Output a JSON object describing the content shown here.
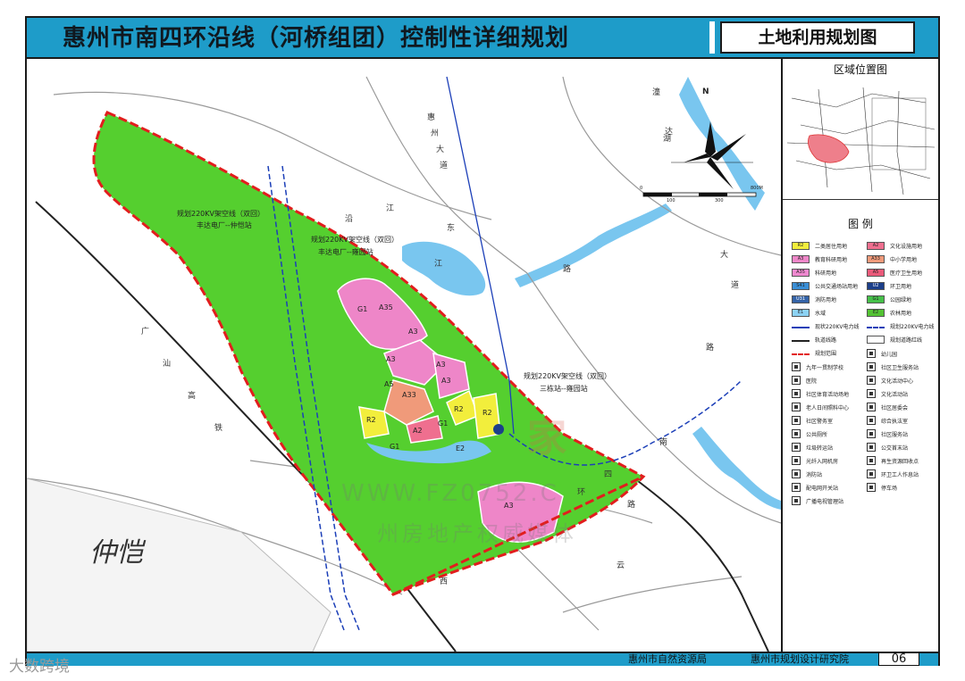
{
  "header": {
    "title": "惠州市南四环沿线（河桥组团）控制性详细规划",
    "sheet_name": "土地利用规划图"
  },
  "location_panel": {
    "title": "区域位置图"
  },
  "scale_bar": {
    "labels": [
      "0",
      "100",
      "300",
      "800M"
    ]
  },
  "north_arrow": {
    "label": "N"
  },
  "legend": {
    "title": "图 例",
    "land_use": [
      {
        "code": "R2",
        "name": "二类居住用地",
        "color": "#f2ee3c"
      },
      {
        "code": "A2",
        "name": "文化设施用地",
        "color": "#ef6f8f"
      },
      {
        "code": "A3",
        "name": "教育科研用地",
        "color": "#ee86c8"
      },
      {
        "code": "A33",
        "name": "中小学用地",
        "color": "#f09a7a"
      },
      {
        "code": "A35",
        "name": "科研用地",
        "color": "#ef88cf"
      },
      {
        "code": "A5",
        "name": "医疗卫生用地",
        "color": "#ea5a7a"
      },
      {
        "code": "S41",
        "name": "公共交通场站用地",
        "color": "#3b8fd6"
      },
      {
        "code": "U2",
        "name": "环卫用地",
        "color": "#1c3f8a"
      },
      {
        "code": "U31",
        "name": "消防用地",
        "color": "#3563a7"
      },
      {
        "code": "G1",
        "name": "公园绿地",
        "color": "#46c04a"
      },
      {
        "code": "E1",
        "name": "水域",
        "color": "#8cd2f4"
      },
      {
        "code": "E2",
        "name": "农林用地",
        "color": "#53c233"
      }
    ],
    "lines": [
      "现状220KV电力线",
      "规划220KV电力线",
      "轨道线路",
      "规划道路红线",
      "规划范围"
    ],
    "facilities": [
      "幼儿园",
      "九年一贯制学校",
      "社区卫生服务站",
      "医院",
      "文化活动中心",
      "社区体育活动场地",
      "文化活动站",
      "老人日间照料中心",
      "社区居委会",
      "社区警务室",
      "综合执法室",
      "公共厕所",
      "社区服务站",
      "垃圾转运站",
      "公交首末站",
      "光纤入网机房",
      "再生资源回收点",
      "消防站",
      "环卫工人作息站",
      "配电网开关站",
      "停车场",
      "广播电视管理站"
    ]
  },
  "map": {
    "annotations": [
      {
        "text": "规划220KV架空线（双回）"
      },
      {
        "text": "丰达电厂--仲恺站"
      },
      {
        "text": "规划220KV架空线（双回）"
      },
      {
        "text": "丰达电厂--雍园站"
      },
      {
        "text": "规划220KV架空线（双回）"
      },
      {
        "text": "三栋站--雍园站"
      }
    ],
    "place_name": "仲恺",
    "parcel_labels": [
      "A35",
      "G1",
      "A3",
      "A3",
      "A33",
      "R2",
      "R2",
      "A3",
      "G1",
      "E2",
      "R2",
      "A3",
      "A3",
      "A2",
      "A5",
      "G1"
    ],
    "road_characters": [
      "广",
      "汕",
      "高",
      "铁",
      "潼",
      "湖",
      "大",
      "道",
      "南",
      "四",
      "环",
      "路",
      "沿",
      "江",
      "路",
      "达",
      "云",
      "西",
      "路",
      "惠",
      "州",
      "大",
      "道",
      "东",
      "江"
    ]
  },
  "footer": {
    "org1": "惠州市自然资源局",
    "org2": "惠州市规划设计研究院",
    "page_number": "06"
  },
  "overlay": {
    "bottom_left_brand": "大数跨境",
    "center_watermark_line1": "家",
    "center_watermark_url": "WWW.FZ0752.C",
    "center_watermark_line2": "州房地产权威媒体"
  }
}
